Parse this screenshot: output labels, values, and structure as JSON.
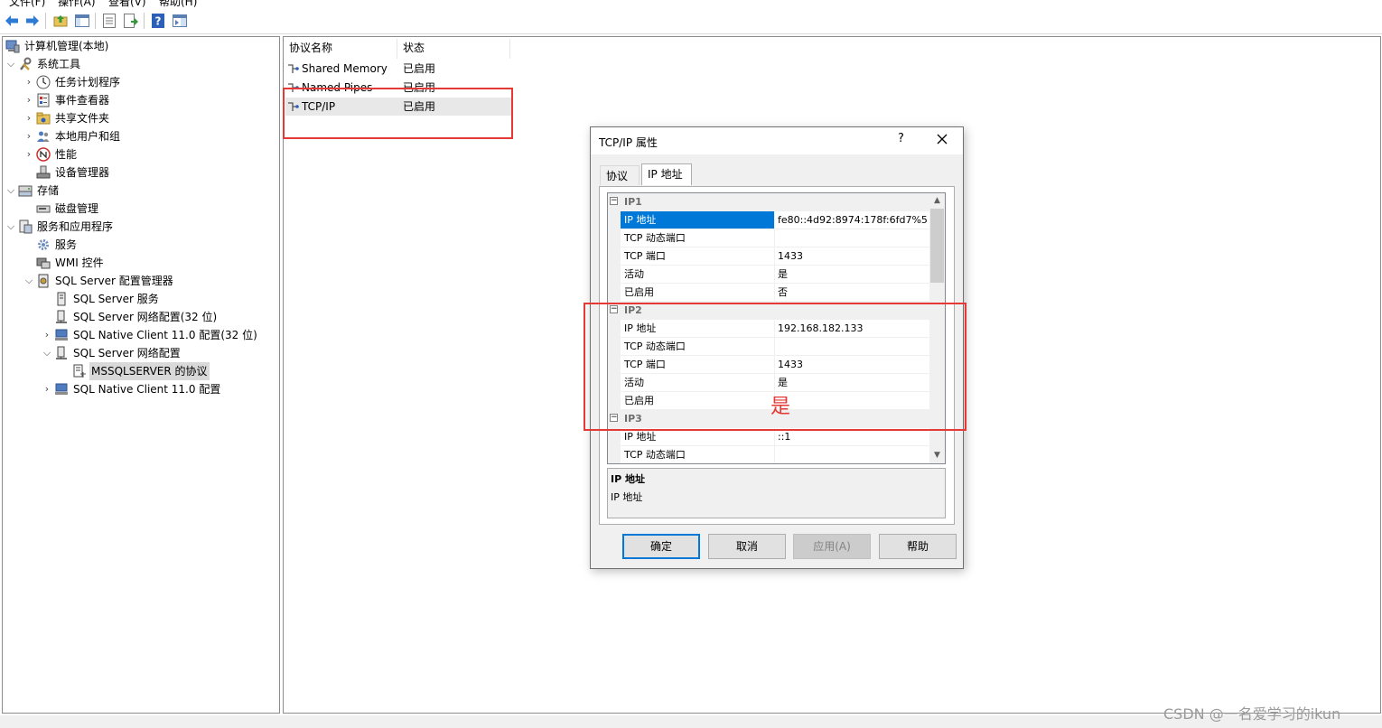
{
  "menu": [
    "文件(F)",
    "操作(A)",
    "查看(V)",
    "帮助(H)"
  ],
  "toolbar": {
    "icons": [
      "back-arrow-icon",
      "forward-arrow-icon",
      "up-folder-icon",
      "show-hide-tree-icon",
      "properties-icon",
      "export-list-icon",
      "help-icon",
      "action-pane-icon"
    ]
  },
  "tree": {
    "root": "计算机管理(本地)",
    "system_tools": "系统工具",
    "task_scheduler": "任务计划程序",
    "event_viewer": "事件查看器",
    "shared_folders": "共享文件夹",
    "local_users": "本地用户和组",
    "performance": "性能",
    "device_manager": "设备管理器",
    "storage": "存储",
    "disk_management": "磁盘管理",
    "services_apps": "服务和应用程序",
    "services": "服务",
    "wmi": "WMI 控件",
    "sql_config_manager": "SQL Server 配置管理器",
    "sql_services": "SQL Server 服务",
    "sql_net_config_32": "SQL Server 网络配置(32 位)",
    "native_client_32": "SQL Native Client 11.0 配置(32 位)",
    "sql_net_config": "SQL Server 网络配置",
    "mssqlserver_protocols": "MSSQLSERVER 的协议",
    "native_client": "SQL Native Client 11.0 配置"
  },
  "protocol_list": {
    "headers": [
      "协议名称",
      "状态"
    ],
    "rows": [
      {
        "name": "Shared Memory",
        "status": "已启用"
      },
      {
        "name": "Named Pipes",
        "status": "已启用"
      },
      {
        "name": "TCP/IP",
        "status": "已启用"
      }
    ]
  },
  "dialog": {
    "title": "TCP/IP 属性",
    "help": "?",
    "tabs": [
      "协议",
      "IP 地址"
    ],
    "active_tab": "IP 地址",
    "sections": [
      {
        "name": "IP1",
        "rows": [
          {
            "key": "IP 地址",
            "value": "fe80::4d92:8974:178f:6fd7%5"
          },
          {
            "key": "TCP 动态端口",
            "value": ""
          },
          {
            "key": "TCP 端口",
            "value": "1433"
          },
          {
            "key": "活动",
            "value": "是"
          },
          {
            "key": "已启用",
            "value": "否"
          }
        ]
      },
      {
        "name": "IP2",
        "rows": [
          {
            "key": "IP 地址",
            "value": "192.168.182.133"
          },
          {
            "key": "TCP 动态端口",
            "value": ""
          },
          {
            "key": "TCP 端口",
            "value": "1433"
          },
          {
            "key": "活动",
            "value": "是"
          },
          {
            "key": "已启用",
            "value": ""
          }
        ]
      },
      {
        "name": "IP3",
        "rows": [
          {
            "key": "IP 地址",
            "value": "::1"
          },
          {
            "key": "TCP 动态端口",
            "value": ""
          }
        ]
      }
    ],
    "description": {
      "title": "IP 地址",
      "text": "IP 地址"
    },
    "buttons": {
      "ok": "确定",
      "cancel": "取消",
      "apply": "应用(A)",
      "help": "帮助"
    }
  },
  "annotation": {
    "handwritten": "是",
    "color": "#e53935"
  },
  "watermark": "CSDN @一名爱学习的ikun",
  "colors": {
    "selection": "#0078d7",
    "annotation_red": "#e53935"
  }
}
